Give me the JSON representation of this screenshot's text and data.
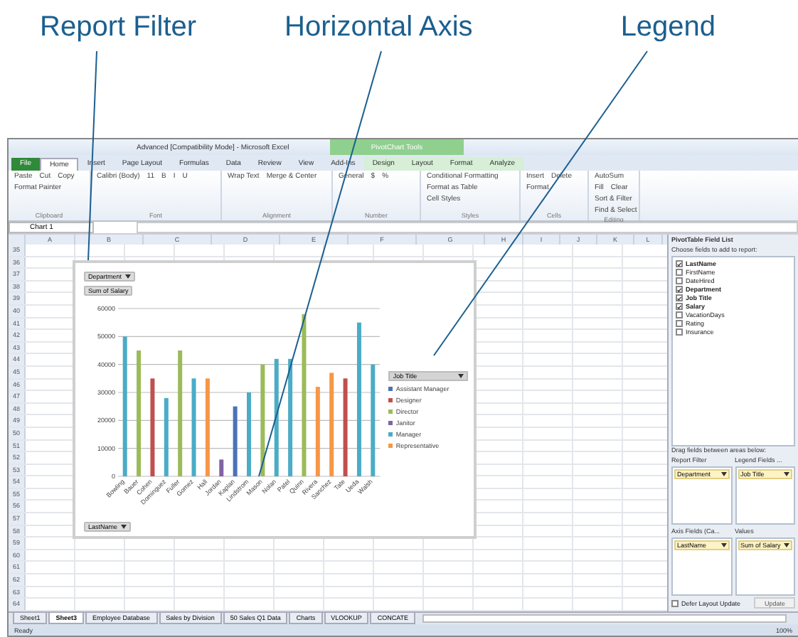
{
  "callouts": [
    {
      "label": "Report Filter"
    },
    {
      "label": "Horizontal Axis"
    },
    {
      "label": "Legend"
    }
  ],
  "window": {
    "title": "Advanced [Compatibility Mode] - Microsoft Excel",
    "context_tab": "PivotChart Tools"
  },
  "ribbon_tabs": [
    {
      "label": "File",
      "selected": false,
      "kind": "file"
    },
    {
      "label": "Home",
      "selected": true,
      "kind": "tab"
    },
    {
      "label": "Insert",
      "selected": false,
      "kind": "tab"
    },
    {
      "label": "Page Layout",
      "selected": false,
      "kind": "tab"
    },
    {
      "label": "Formulas",
      "selected": false,
      "kind": "tab"
    },
    {
      "label": "Data",
      "selected": false,
      "kind": "tab"
    },
    {
      "label": "Review",
      "selected": false,
      "kind": "tab"
    },
    {
      "label": "View",
      "selected": false,
      "kind": "tab"
    },
    {
      "label": "Add-Ins",
      "selected": false,
      "kind": "tab"
    },
    {
      "label": "Design",
      "selected": false,
      "kind": "context"
    },
    {
      "label": "Layout",
      "selected": false,
      "kind": "context"
    },
    {
      "label": "Format",
      "selected": false,
      "kind": "context"
    },
    {
      "label": "Analyze",
      "selected": false,
      "kind": "context"
    }
  ],
  "ribbon_groups": [
    {
      "name": "Clipboard",
      "buttons": [
        "Paste",
        "Cut",
        "Copy",
        "Format Painter"
      ]
    },
    {
      "name": "Font",
      "buttons": [
        "Calibri (Body)",
        "11",
        "B",
        "I",
        "U"
      ]
    },
    {
      "name": "Alignment",
      "buttons": [
        "Wrap Text",
        "Merge & Center"
      ]
    },
    {
      "name": "Number",
      "buttons": [
        "General",
        "$",
        "%"
      ]
    },
    {
      "name": "Styles",
      "buttons": [
        "Conditional Formatting",
        "Format as Table",
        "Cell Styles"
      ]
    },
    {
      "name": "Cells",
      "buttons": [
        "Insert",
        "Delete",
        "Format"
      ]
    },
    {
      "name": "Editing",
      "buttons": [
        "AutoSum",
        "Fill",
        "Clear",
        "Sort & Filter",
        "Find & Select"
      ]
    }
  ],
  "name_box": "Chart 1",
  "column_headers": [
    "A",
    "B",
    "C",
    "D",
    "E",
    "F",
    "G",
    "H",
    "I",
    "J",
    "K",
    "L"
  ],
  "row_numbers": [
    "35",
    "36",
    "37",
    "38",
    "39",
    "40",
    "41",
    "42",
    "43",
    "44",
    "45",
    "46",
    "47",
    "48",
    "49",
    "50",
    "51",
    "52",
    "53",
    "54",
    "55",
    "56",
    "57",
    "58",
    "59",
    "60",
    "61",
    "62",
    "63",
    "64"
  ],
  "chart": {
    "report_filter": "Department",
    "values_button": "Sum of Salary",
    "axis_button": "LastName",
    "legend_title": "Job Title",
    "chart_data": {
      "type": "bar",
      "grid": true,
      "categories": [
        "Bowling",
        "Bauer",
        "Cohen",
        "Dominguez",
        "Fuller",
        "Gomez",
        "Hall",
        "Jordan",
        "Kaplan",
        "Lindstrom",
        "Mason",
        "Nolan",
        "Patel",
        "Quinn",
        "Rivera",
        "Sanchez",
        "Tate",
        "Ueda",
        "Walsh"
      ],
      "ylim": [
        0,
        60000
      ],
      "yticks": [
        0,
        10000,
        20000,
        30000,
        40000,
        50000,
        60000
      ],
      "series": [
        {
          "name": "Assistant Manager",
          "color": "#4a72b8",
          "values": [
            null,
            null,
            null,
            null,
            null,
            null,
            null,
            null,
            25000,
            null,
            null,
            null,
            null,
            null,
            null,
            null,
            null,
            null,
            null
          ]
        },
        {
          "name": "Designer",
          "color": "#c0504d",
          "values": [
            null,
            null,
            35000,
            null,
            null,
            null,
            null,
            null,
            null,
            null,
            null,
            null,
            null,
            null,
            null,
            null,
            35000,
            null,
            null
          ]
        },
        {
          "name": "Director",
          "color": "#9bbb59",
          "values": [
            null,
            45000,
            null,
            null,
            45000,
            null,
            null,
            null,
            null,
            null,
            40000,
            null,
            null,
            58000,
            null,
            null,
            null,
            null,
            null
          ]
        },
        {
          "name": "Janitor",
          "color": "#8064a2",
          "values": [
            null,
            null,
            null,
            null,
            null,
            null,
            null,
            6000,
            null,
            null,
            null,
            null,
            null,
            null,
            null,
            null,
            null,
            null,
            null
          ]
        },
        {
          "name": "Manager",
          "color": "#4bacc6",
          "values": [
            50000,
            null,
            null,
            28000,
            null,
            35000,
            null,
            null,
            null,
            30000,
            null,
            42000,
            42000,
            null,
            null,
            null,
            null,
            55000,
            40000
          ]
        },
        {
          "name": "Representative",
          "color": "#f79646",
          "values": [
            null,
            null,
            null,
            null,
            null,
            null,
            35000,
            null,
            null,
            null,
            null,
            null,
            null,
            null,
            32000,
            37000,
            null,
            null,
            null
          ]
        }
      ]
    }
  },
  "field_list": {
    "title": "PivotTable Field List",
    "choose_label": "Choose fields to add to report:",
    "fields": [
      {
        "name": "LastName",
        "checked": true
      },
      {
        "name": "FirstName",
        "checked": false
      },
      {
        "name": "DateHired",
        "checked": false
      },
      {
        "name": "Department",
        "checked": true
      },
      {
        "name": "Job Title",
        "checked": true
      },
      {
        "name": "Salary",
        "checked": true
      },
      {
        "name": "VacationDays",
        "checked": false
      },
      {
        "name": "Rating",
        "checked": false
      },
      {
        "name": "Insurance",
        "checked": false
      }
    ],
    "drag_label": "Drag fields between areas below:",
    "areas": [
      {
        "title": "Report Filter",
        "item": "Department"
      },
      {
        "title": "Legend Fields ...",
        "item": "Job Title"
      },
      {
        "title": "Axis Fields (Ca...",
        "item": "LastName"
      },
      {
        "title": "Values",
        "item": "Sum of Salary"
      }
    ],
    "defer": {
      "label": "Defer Layout Update",
      "checked": false
    },
    "update": {
      "label": "Update",
      "disabled": true
    }
  },
  "sheet_tabs": [
    {
      "label": "Sheet1",
      "selected": false
    },
    {
      "label": "Sheet3",
      "selected": true
    },
    {
      "label": "Employee Database",
      "selected": false
    },
    {
      "label": "Sales by Division",
      "selected": false
    },
    {
      "label": "50 Sales Q1 Data",
      "selected": false
    },
    {
      "label": "Charts",
      "selected": false
    },
    {
      "label": "VLOOKUP",
      "selected": false
    },
    {
      "label": "CONCATE",
      "selected": false
    }
  ],
  "status_bar": {
    "text": "Ready",
    "zoom": "100%"
  }
}
